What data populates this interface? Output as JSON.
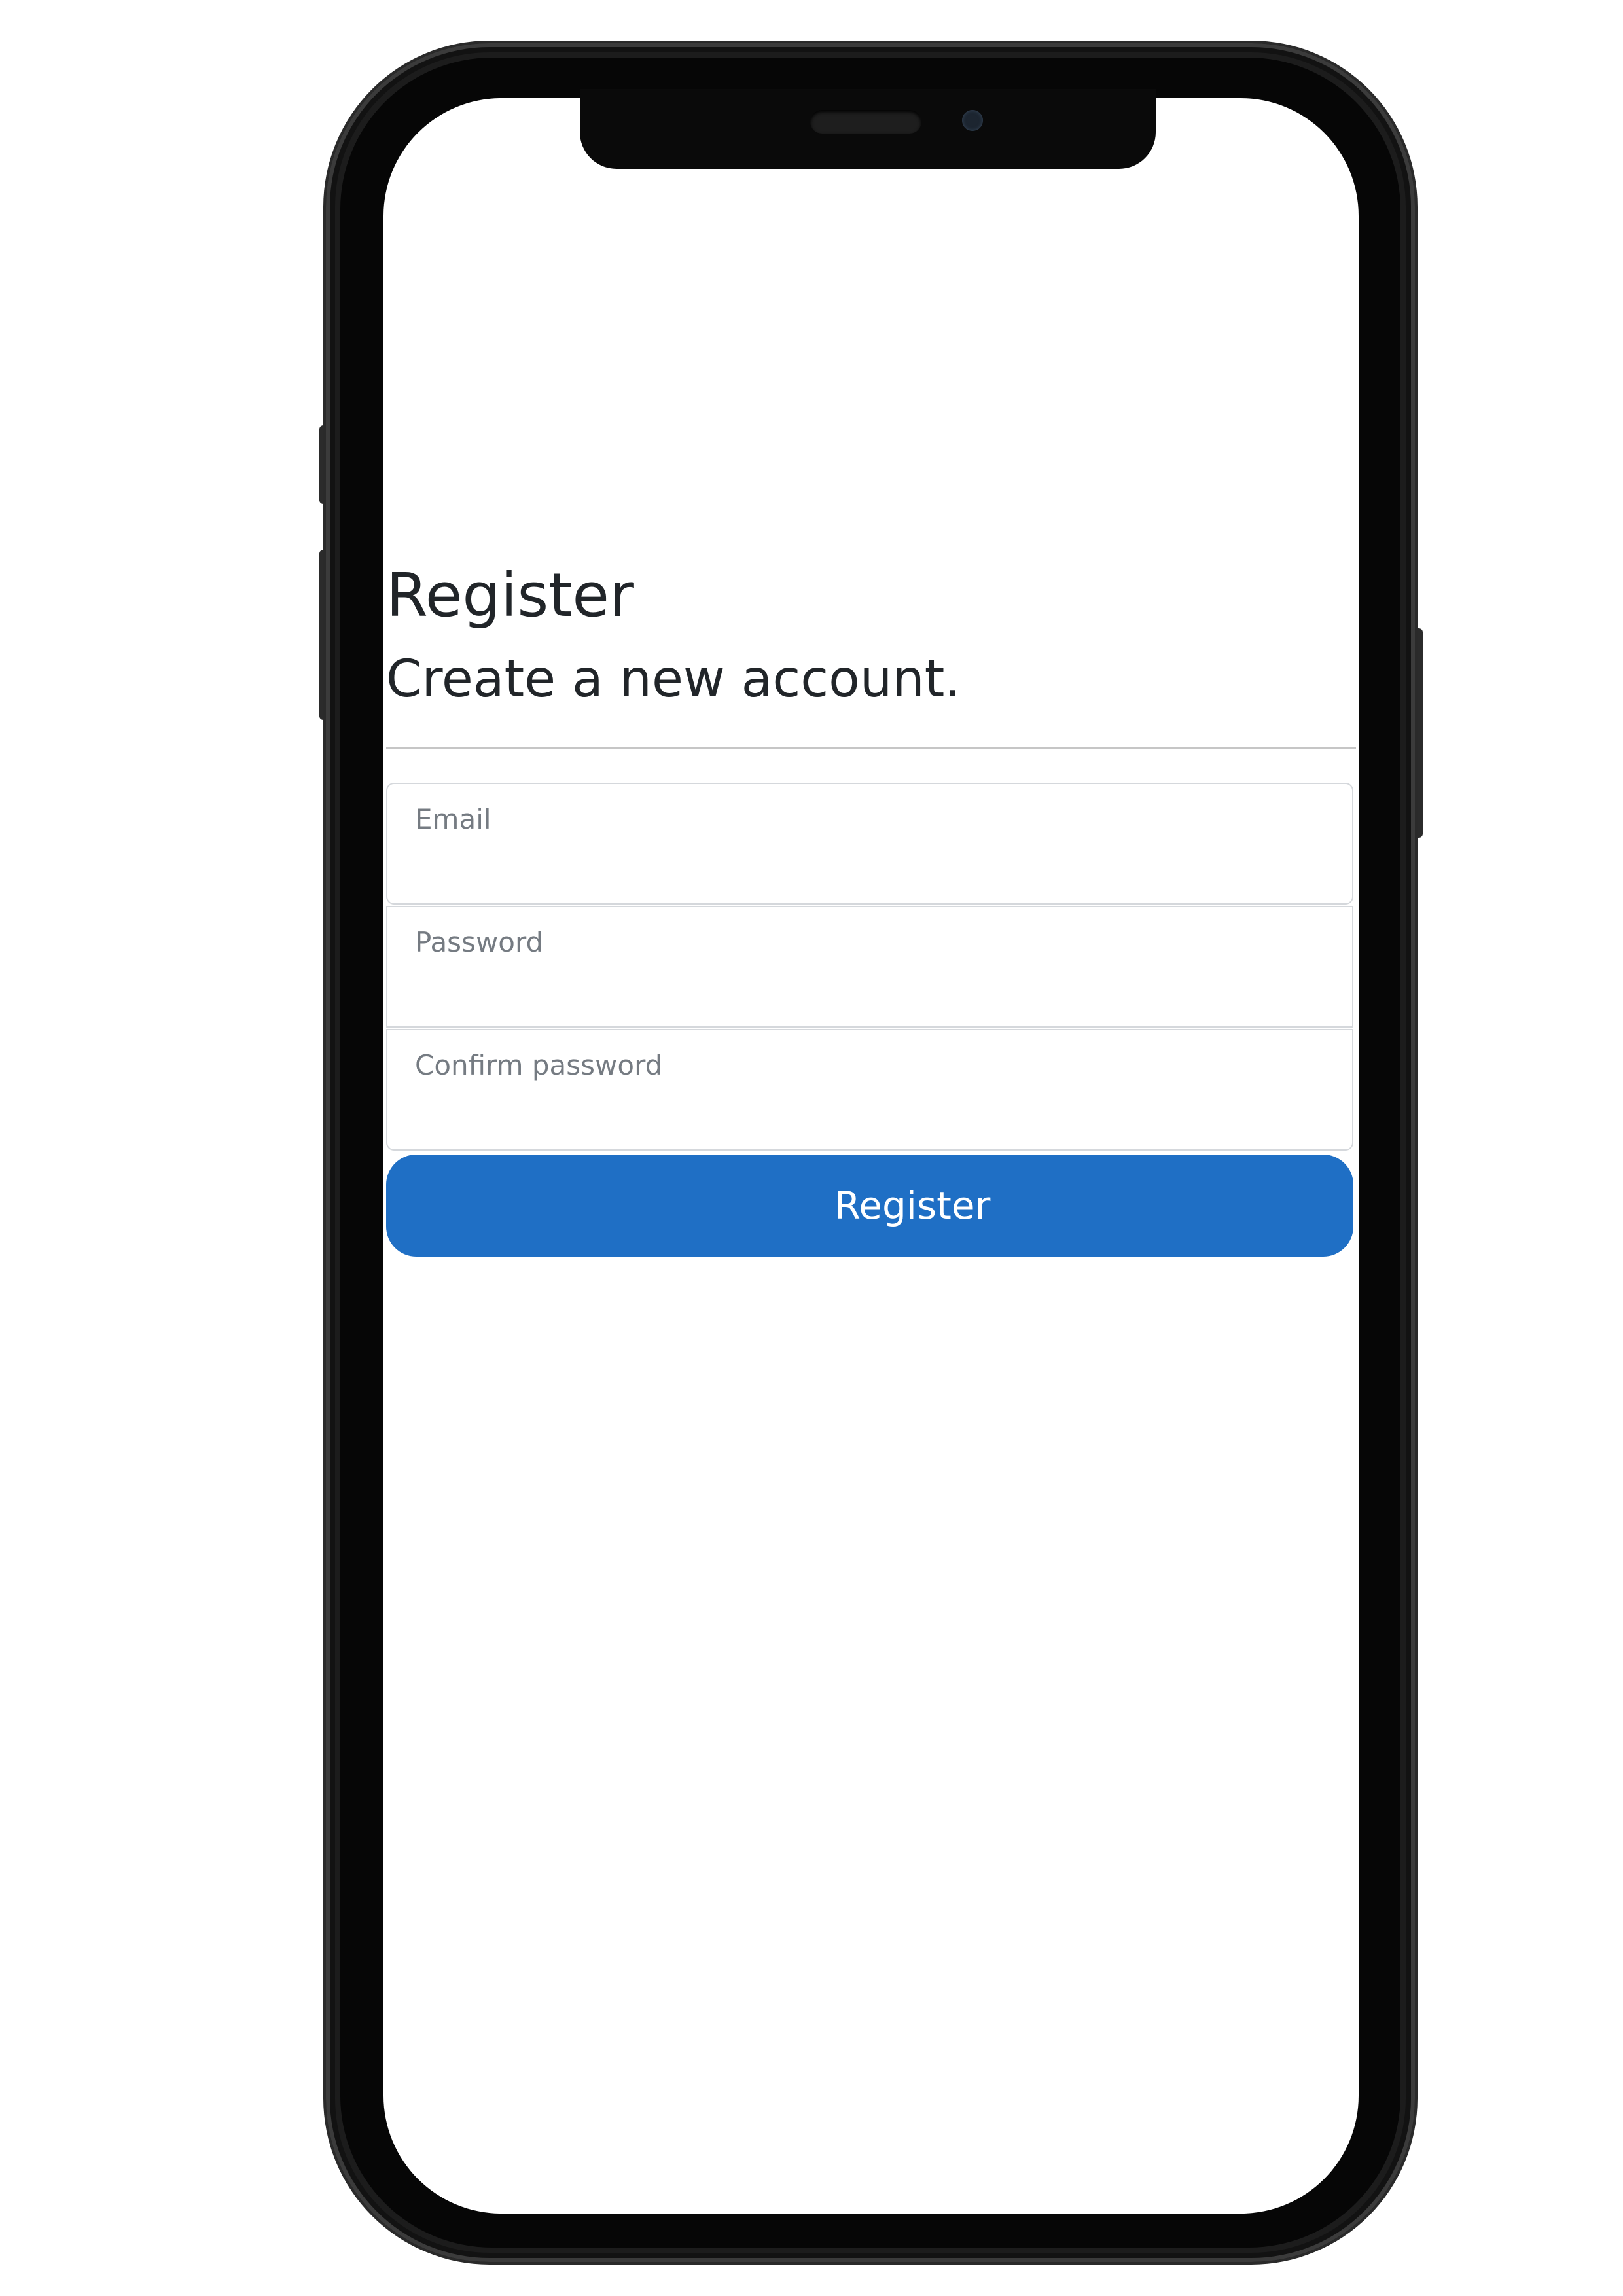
{
  "page": {
    "title": "Register",
    "subtitle": "Create a new account."
  },
  "form": {
    "email_placeholder": "Email",
    "password_placeholder": "Password",
    "confirm_password_placeholder": "Confirm password",
    "submit_label": "Register"
  },
  "colors": {
    "primary_button": "#1f6fc5",
    "text": "#212529",
    "placeholder": "#757b82",
    "phone_frame": "#1c1c1c"
  }
}
